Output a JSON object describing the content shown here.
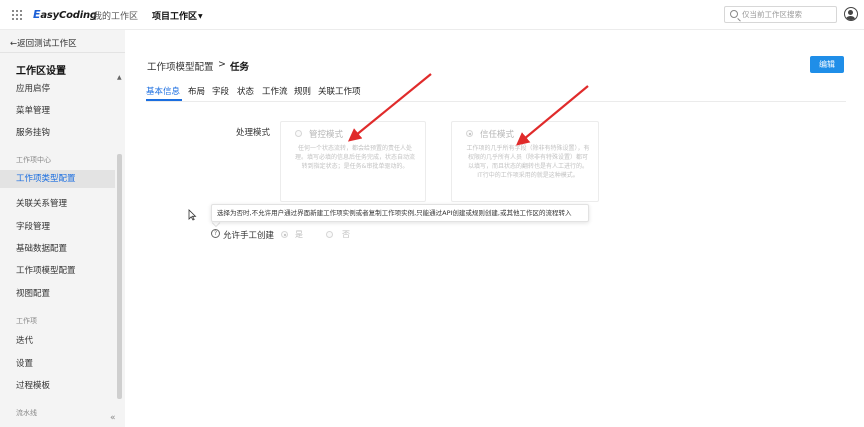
{
  "topbar": {
    "logo_e": "E",
    "logo_rest": "asyCoding",
    "nav_mine": "我的工作区",
    "nav_project": "项目工作区",
    "search_placeholder": "仅当前工作区搜索"
  },
  "sidebar": {
    "back_link": "←返回测试工作区",
    "title": "工作区设置",
    "items_top": [
      "应用启停",
      "菜单管理",
      "服务挂钩"
    ],
    "group_workitem_center": "工作项中心",
    "items_center": [
      "工作项类型配置",
      "关联关系管理",
      "字段管理",
      "基础数据配置",
      "工作项模型配置",
      "视图配置"
    ],
    "active_item": "工作项类型配置",
    "group_workitem": "工作项",
    "items_workitem": [
      "迭代",
      "设置",
      "过程模板"
    ],
    "group_pipeline": "流水线"
  },
  "main": {
    "breadcrumb_parent": "工作项模型配置",
    "breadcrumb_sep": ">",
    "breadcrumb_current": "任务",
    "edit_label": "编辑",
    "tabs": [
      "基本信息",
      "布局",
      "字段",
      "状态",
      "工作流",
      "规则",
      "关联工作项"
    ],
    "active_tab": "基本信息",
    "process_label": "处理模式",
    "mode_controlled": {
      "title": "管控模式",
      "desc": "任何一个状态流转，都会给预置的责任人处理。填写必填的信息后任务完成，状态自动流转到指定状态；是任务&审批单驱动的。"
    },
    "mode_trust": {
      "title": "信任模式",
      "desc": "工作项的几乎所有字段（除非有特殊设置），有权限的几乎所有人员（除非有特殊设置）都可以填写，而且状态的翻转也是有人工进行的。IT行中的工作项采用的就是这种模式。"
    },
    "tooltip": "选择为否时,不允许用户通过界面新建工作项实例或者复制工作项实例,只能通过API创建或规则创建,或其他工作区的流程转入",
    "allow_manual_label": "允许手工创建",
    "opt_yes": "是",
    "opt_no": "否"
  },
  "colors": {
    "accent": "#1b6ee0",
    "button": "#1f8ee8",
    "annotation": "#e02b2b"
  }
}
